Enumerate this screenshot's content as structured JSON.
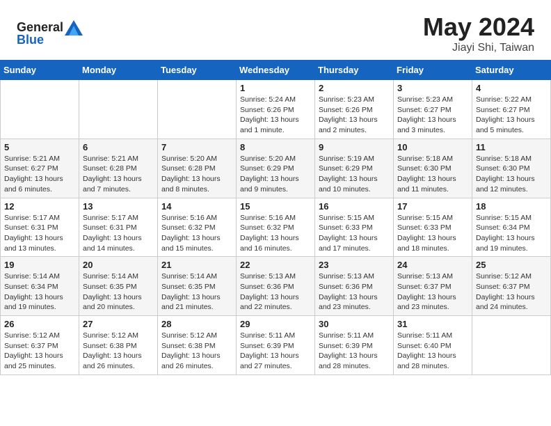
{
  "logo": {
    "text_general": "General",
    "text_blue": "Blue"
  },
  "title": "May 2024",
  "subtitle": "Jiayi Shi, Taiwan",
  "weekdays": [
    "Sunday",
    "Monday",
    "Tuesday",
    "Wednesday",
    "Thursday",
    "Friday",
    "Saturday"
  ],
  "weeks": [
    [
      null,
      null,
      null,
      {
        "day": "1",
        "sunrise": "Sunrise: 5:24 AM",
        "sunset": "Sunset: 6:26 PM",
        "daylight": "Daylight: 13 hours and 1 minute."
      },
      {
        "day": "2",
        "sunrise": "Sunrise: 5:23 AM",
        "sunset": "Sunset: 6:26 PM",
        "daylight": "Daylight: 13 hours and 2 minutes."
      },
      {
        "day": "3",
        "sunrise": "Sunrise: 5:23 AM",
        "sunset": "Sunset: 6:27 PM",
        "daylight": "Daylight: 13 hours and 3 minutes."
      },
      {
        "day": "4",
        "sunrise": "Sunrise: 5:22 AM",
        "sunset": "Sunset: 6:27 PM",
        "daylight": "Daylight: 13 hours and 5 minutes."
      }
    ],
    [
      {
        "day": "5",
        "sunrise": "Sunrise: 5:21 AM",
        "sunset": "Sunset: 6:27 PM",
        "daylight": "Daylight: 13 hours and 6 minutes."
      },
      {
        "day": "6",
        "sunrise": "Sunrise: 5:21 AM",
        "sunset": "Sunset: 6:28 PM",
        "daylight": "Daylight: 13 hours and 7 minutes."
      },
      {
        "day": "7",
        "sunrise": "Sunrise: 5:20 AM",
        "sunset": "Sunset: 6:28 PM",
        "daylight": "Daylight: 13 hours and 8 minutes."
      },
      {
        "day": "8",
        "sunrise": "Sunrise: 5:20 AM",
        "sunset": "Sunset: 6:29 PM",
        "daylight": "Daylight: 13 hours and 9 minutes."
      },
      {
        "day": "9",
        "sunrise": "Sunrise: 5:19 AM",
        "sunset": "Sunset: 6:29 PM",
        "daylight": "Daylight: 13 hours and 10 minutes."
      },
      {
        "day": "10",
        "sunrise": "Sunrise: 5:18 AM",
        "sunset": "Sunset: 6:30 PM",
        "daylight": "Daylight: 13 hours and 11 minutes."
      },
      {
        "day": "11",
        "sunrise": "Sunrise: 5:18 AM",
        "sunset": "Sunset: 6:30 PM",
        "daylight": "Daylight: 13 hours and 12 minutes."
      }
    ],
    [
      {
        "day": "12",
        "sunrise": "Sunrise: 5:17 AM",
        "sunset": "Sunset: 6:31 PM",
        "daylight": "Daylight: 13 hours and 13 minutes."
      },
      {
        "day": "13",
        "sunrise": "Sunrise: 5:17 AM",
        "sunset": "Sunset: 6:31 PM",
        "daylight": "Daylight: 13 hours and 14 minutes."
      },
      {
        "day": "14",
        "sunrise": "Sunrise: 5:16 AM",
        "sunset": "Sunset: 6:32 PM",
        "daylight": "Daylight: 13 hours and 15 minutes."
      },
      {
        "day": "15",
        "sunrise": "Sunrise: 5:16 AM",
        "sunset": "Sunset: 6:32 PM",
        "daylight": "Daylight: 13 hours and 16 minutes."
      },
      {
        "day": "16",
        "sunrise": "Sunrise: 5:15 AM",
        "sunset": "Sunset: 6:33 PM",
        "daylight": "Daylight: 13 hours and 17 minutes."
      },
      {
        "day": "17",
        "sunrise": "Sunrise: 5:15 AM",
        "sunset": "Sunset: 6:33 PM",
        "daylight": "Daylight: 13 hours and 18 minutes."
      },
      {
        "day": "18",
        "sunrise": "Sunrise: 5:15 AM",
        "sunset": "Sunset: 6:34 PM",
        "daylight": "Daylight: 13 hours and 19 minutes."
      }
    ],
    [
      {
        "day": "19",
        "sunrise": "Sunrise: 5:14 AM",
        "sunset": "Sunset: 6:34 PM",
        "daylight": "Daylight: 13 hours and 19 minutes."
      },
      {
        "day": "20",
        "sunrise": "Sunrise: 5:14 AM",
        "sunset": "Sunset: 6:35 PM",
        "daylight": "Daylight: 13 hours and 20 minutes."
      },
      {
        "day": "21",
        "sunrise": "Sunrise: 5:14 AM",
        "sunset": "Sunset: 6:35 PM",
        "daylight": "Daylight: 13 hours and 21 minutes."
      },
      {
        "day": "22",
        "sunrise": "Sunrise: 5:13 AM",
        "sunset": "Sunset: 6:36 PM",
        "daylight": "Daylight: 13 hours and 22 minutes."
      },
      {
        "day": "23",
        "sunrise": "Sunrise: 5:13 AM",
        "sunset": "Sunset: 6:36 PM",
        "daylight": "Daylight: 13 hours and 23 minutes."
      },
      {
        "day": "24",
        "sunrise": "Sunrise: 5:13 AM",
        "sunset": "Sunset: 6:37 PM",
        "daylight": "Daylight: 13 hours and 23 minutes."
      },
      {
        "day": "25",
        "sunrise": "Sunrise: 5:12 AM",
        "sunset": "Sunset: 6:37 PM",
        "daylight": "Daylight: 13 hours and 24 minutes."
      }
    ],
    [
      {
        "day": "26",
        "sunrise": "Sunrise: 5:12 AM",
        "sunset": "Sunset: 6:37 PM",
        "daylight": "Daylight: 13 hours and 25 minutes."
      },
      {
        "day": "27",
        "sunrise": "Sunrise: 5:12 AM",
        "sunset": "Sunset: 6:38 PM",
        "daylight": "Daylight: 13 hours and 26 minutes."
      },
      {
        "day": "28",
        "sunrise": "Sunrise: 5:12 AM",
        "sunset": "Sunset: 6:38 PM",
        "daylight": "Daylight: 13 hours and 26 minutes."
      },
      {
        "day": "29",
        "sunrise": "Sunrise: 5:11 AM",
        "sunset": "Sunset: 6:39 PM",
        "daylight": "Daylight: 13 hours and 27 minutes."
      },
      {
        "day": "30",
        "sunrise": "Sunrise: 5:11 AM",
        "sunset": "Sunset: 6:39 PM",
        "daylight": "Daylight: 13 hours and 28 minutes."
      },
      {
        "day": "31",
        "sunrise": "Sunrise: 5:11 AM",
        "sunset": "Sunset: 6:40 PM",
        "daylight": "Daylight: 13 hours and 28 minutes."
      },
      null
    ]
  ]
}
